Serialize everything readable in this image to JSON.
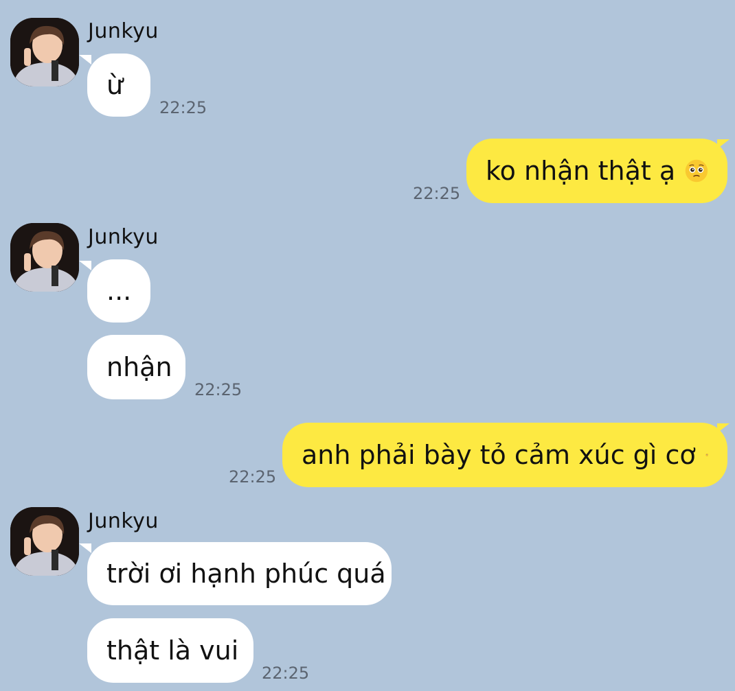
{
  "contact": {
    "name": "Junkyu"
  },
  "messages": [
    {
      "sender": "Junkyu",
      "text": "ừ",
      "time": "22:25"
    },
    {
      "sender": "me",
      "text": "ko nhận thật ạ",
      "emoji": "pleading-face",
      "time": "22:25"
    },
    {
      "sender": "Junkyu",
      "text": "...",
      "time": ""
    },
    {
      "sender": "Junkyu",
      "text": "nhận",
      "time": "22:25"
    },
    {
      "sender": "me",
      "text": "anh phải bày tỏ cảm xúc gì cơ",
      "emoji": "pleading-face",
      "time": "22:25"
    },
    {
      "sender": "Junkyu",
      "text": "trời ơi hạnh phúc quá",
      "time": ""
    },
    {
      "sender": "Junkyu",
      "text": "thật là vui",
      "time": "22:25"
    }
  ],
  "colors": {
    "background": "#b1c5da",
    "incoming_bubble": "#ffffff",
    "outgoing_bubble": "#fde942"
  }
}
